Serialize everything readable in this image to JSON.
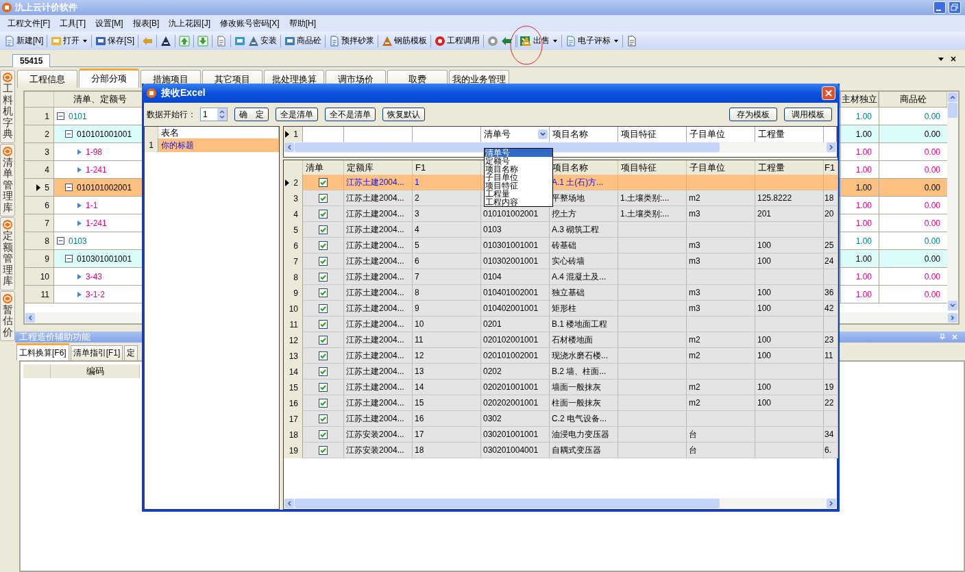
{
  "window": {
    "title": "氿上云计价软件"
  },
  "menu": [
    "工程文件[F]",
    "工具[T]",
    "设置[M]",
    "报表[B]",
    "氿上花园[J]",
    "修改账号密码[X]",
    "帮助[H]"
  ],
  "toolbar": [
    {
      "kind": "button",
      "label": "新建[N]",
      "dropdown": false
    },
    {
      "kind": "separator"
    },
    {
      "kind": "button",
      "label": "打开",
      "dropdown": true
    },
    {
      "kind": "separator"
    },
    {
      "kind": "button",
      "label": "保存[S]",
      "dropdown": false
    },
    {
      "kind": "separator"
    },
    {
      "kind": "icon"
    },
    {
      "kind": "separator"
    },
    {
      "kind": "icon"
    },
    {
      "kind": "separator"
    },
    {
      "kind": "icon"
    },
    {
      "kind": "separator"
    },
    {
      "kind": "icon"
    },
    {
      "kind": "separator"
    },
    {
      "kind": "icon"
    },
    {
      "kind": "separator"
    },
    {
      "kind": "icon"
    },
    {
      "kind": "button",
      "label": "安装",
      "dropdown": false
    },
    {
      "kind": "separator"
    },
    {
      "kind": "button",
      "label": "商品砼",
      "dropdown": false
    },
    {
      "kind": "separator"
    },
    {
      "kind": "button",
      "label": "预拌砂浆",
      "dropdown": false
    },
    {
      "kind": "separator"
    },
    {
      "kind": "button",
      "label": "钢筋模板",
      "dropdown": false
    },
    {
      "kind": "separator"
    },
    {
      "kind": "button",
      "label": "工程调用",
      "dropdown": false
    },
    {
      "kind": "separator"
    },
    {
      "kind": "icon"
    },
    {
      "kind": "icon"
    },
    {
      "kind": "separator"
    },
    {
      "kind": "icon"
    },
    {
      "kind": "separator"
    },
    {
      "kind": "button",
      "label": "出售",
      "dropdown": true
    },
    {
      "kind": "separator"
    },
    {
      "kind": "button",
      "label": "电子评标",
      "dropdown": true
    },
    {
      "kind": "separator"
    },
    {
      "kind": "icon"
    }
  ],
  "doc_tabs": [
    {
      "label": "55415",
      "selected": true
    }
  ],
  "side_tabs": [
    "工料机字典",
    "清单管理库",
    "定额管理库",
    "暂估价"
  ],
  "tabs": [
    {
      "label": "工程信息",
      "selected": false
    },
    {
      "label": "分部分项",
      "selected": true
    },
    {
      "label": "措施项目",
      "selected": false
    },
    {
      "label": "其它项目",
      "selected": false
    },
    {
      "label": "批处理换算",
      "selected": false
    },
    {
      "label": "调市场价",
      "selected": false
    },
    {
      "label": "取费",
      "selected": false
    },
    {
      "label": "我的业务管理",
      "selected": false
    }
  ],
  "grid": {
    "columns": [
      "清单、定额号",
      "主材独立",
      "商品砼"
    ],
    "rows": [
      {
        "no": "1",
        "kind": "group",
        "expanded": true,
        "code": "0101",
        "values": [
          "1.00",
          "0.00"
        ],
        "selected": false
      },
      {
        "no": "2",
        "kind": "list",
        "expanded": true,
        "code": "010101001001",
        "values": [
          "1.00",
          "0.00"
        ],
        "selected": false
      },
      {
        "no": "3",
        "kind": "quota",
        "code": "1-98",
        "values": [
          "1.00",
          "0.00"
        ],
        "selected": false
      },
      {
        "no": "4",
        "kind": "quota",
        "code": "1-241",
        "values": [
          "1.00",
          "0.00"
        ],
        "selected": false
      },
      {
        "no": "5",
        "kind": "list",
        "expanded": true,
        "code": "010101002001",
        "values": [
          "1.00",
          "0.00"
        ],
        "selected": true
      },
      {
        "no": "6",
        "kind": "quota",
        "code": "1-1",
        "values": [
          "1.00",
          "0.00"
        ],
        "selected": false
      },
      {
        "no": "7",
        "kind": "quota",
        "code": "1-241",
        "values": [
          "1.00",
          "0.00"
        ],
        "selected": false
      },
      {
        "no": "8",
        "kind": "group",
        "expanded": true,
        "code": "0103",
        "values": [
          "1.00",
          "0.00"
        ],
        "selected": false
      },
      {
        "no": "9",
        "kind": "list",
        "expanded": true,
        "code": "010301001001",
        "values": [
          "1.00",
          "0.00"
        ],
        "selected": false
      },
      {
        "no": "10",
        "kind": "quota",
        "code": "3-43",
        "values": [
          "1.00",
          "0.00"
        ],
        "selected": false
      },
      {
        "no": "11",
        "kind": "quota",
        "code": "3-1-2",
        "values": [
          "1.00",
          "0.00"
        ],
        "selected": false
      }
    ]
  },
  "bottom_panel": {
    "title": "工程造价辅助功能",
    "tabs": [
      {
        "label": "工料换算[F6]",
        "selected": true
      },
      {
        "label": "清单指引[F1]",
        "selected": false
      },
      {
        "label": "定",
        "selected": false
      }
    ],
    "columns": [
      "编码"
    ]
  },
  "dialog": {
    "title": "接收Excel",
    "start_row_label": "数据开始行：",
    "start_row": "1",
    "buttons": [
      "确　定",
      "全是清单",
      "全不是清单",
      "恢复默认"
    ],
    "right_buttons": [
      "存为模板",
      "调用模板"
    ],
    "sheets": {
      "column": "表名",
      "rows": [
        {
          "no": "1",
          "name": "你的标题",
          "selected": true
        }
      ]
    },
    "mapping": {
      "row": "1",
      "cells": [
        {
          "kind": "empty"
        },
        {
          "kind": "empty"
        },
        {
          "kind": "empty"
        },
        {
          "kind": "combo",
          "value": "清单号"
        },
        {
          "kind": "text",
          "value": "项目名称"
        },
        {
          "kind": "text",
          "value": "项目特征"
        },
        {
          "kind": "text",
          "value": "子目单位"
        },
        {
          "kind": "text",
          "value": "工程量"
        }
      ]
    },
    "dropdown": [
      {
        "label": "清单号",
        "selected": true
      },
      {
        "label": "定额号",
        "selected": false
      },
      {
        "label": "项目名称",
        "selected": false
      },
      {
        "label": "子目单位",
        "selected": false
      },
      {
        "label": "项目特征",
        "selected": false
      },
      {
        "label": "工程量",
        "selected": false
      },
      {
        "label": "工程内容",
        "selected": false
      }
    ],
    "table": {
      "columns_left": [
        "清单",
        "定额库",
        "F1"
      ],
      "columns_right": [
        "项目名称",
        "项目特征",
        "子目单位",
        "工程量",
        "F1"
      ],
      "rows": [
        {
          "no": "2",
          "checked": true,
          "selected": true,
          "library": "江苏土建2004...",
          "f1": "1",
          "name": "A.1 土(石)方..."
        },
        {
          "no": "3",
          "checked": true,
          "selected": false,
          "library": "江苏土建2004...",
          "f1": "2",
          "name": "平整场地",
          "feature": "1.土壤类别:...",
          "unit": "m2",
          "qty": "125.8222",
          "f1b": "18"
        },
        {
          "no": "4",
          "checked": true,
          "selected": false,
          "library": "江苏土建2004...",
          "f1": "3",
          "code": "010101002001",
          "name": "挖土方",
          "feature": "1.土壤类别:...",
          "unit": "m3",
          "qty": "201",
          "f1b": "20"
        },
        {
          "no": "5",
          "checked": true,
          "selected": false,
          "library": "江苏土建2004...",
          "f1": "4",
          "code": "0103",
          "name": "A.3 砌筑工程"
        },
        {
          "no": "6",
          "checked": true,
          "selected": false,
          "library": "江苏土建2004...",
          "f1": "5",
          "code": "010301001001",
          "name": "砖基础",
          "unit": "m3",
          "qty": "100",
          "f1b": "25"
        },
        {
          "no": "7",
          "checked": true,
          "selected": false,
          "library": "江苏土建2004...",
          "f1": "6",
          "code": "010302001001",
          "name": "实心砖墙",
          "unit": "m3",
          "qty": "100",
          "f1b": "24"
        },
        {
          "no": "8",
          "checked": true,
          "selected": false,
          "library": "江苏土建2004...",
          "f1": "7",
          "code": "0104",
          "name": "A.4 混凝土及..."
        },
        {
          "no": "9",
          "checked": true,
          "selected": false,
          "library": "江苏土建2004...",
          "f1": "8",
          "code": "010401002001",
          "name": "独立基础",
          "unit": "m3",
          "qty": "100",
          "f1b": "36"
        },
        {
          "no": "10",
          "checked": true,
          "selected": false,
          "library": "江苏土建2004...",
          "f1": "9",
          "code": "010402001001",
          "name": "矩形柱",
          "unit": "m3",
          "qty": "100",
          "f1b": "42"
        },
        {
          "no": "11",
          "checked": true,
          "selected": false,
          "library": "江苏土建2004...",
          "f1": "10",
          "code": "0201",
          "name": "B.1 楼地面工程"
        },
        {
          "no": "12",
          "checked": true,
          "selected": false,
          "library": "江苏土建2004...",
          "f1": "11",
          "code": "020102001001",
          "name": "石材楼地面",
          "unit": "m2",
          "qty": "100",
          "f1b": "23"
        },
        {
          "no": "13",
          "checked": true,
          "selected": false,
          "library": "江苏土建2004...",
          "f1": "12",
          "code": "020101002001",
          "name": "现浇水磨石楼...",
          "unit": "m2",
          "qty": "100",
          "f1b": "11"
        },
        {
          "no": "14",
          "checked": true,
          "selected": false,
          "library": "江苏土建2004...",
          "f1": "13",
          "code": "0202",
          "name": "B.2 墙、柱面..."
        },
        {
          "no": "15",
          "checked": true,
          "selected": false,
          "library": "江苏土建2004...",
          "f1": "14",
          "code": "020201001001",
          "name": "墙面一般抹灰",
          "unit": "m2",
          "qty": "100",
          "f1b": "19"
        },
        {
          "no": "16",
          "checked": true,
          "selected": false,
          "library": "江苏土建2004...",
          "f1": "15",
          "code": "020202001001",
          "name": "柱面一般抹灰",
          "unit": "m2",
          "qty": "100",
          "f1b": "22"
        },
        {
          "no": "17",
          "checked": true,
          "selected": false,
          "library": "江苏土建2004...",
          "f1": "16",
          "code": "0302",
          "name": "C.2 电气设备..."
        },
        {
          "no": "18",
          "checked": true,
          "selected": false,
          "library": "江苏安装2004...",
          "f1": "17",
          "code": "030201001001",
          "name": "油浸电力变压器",
          "unit": "台",
          "f1b": "34"
        },
        {
          "no": "19",
          "checked": true,
          "selected": false,
          "library": "江苏安装2004...",
          "f1": "18",
          "code": "030201004001",
          "name": "自耦式变压器",
          "unit": "台",
          "f1b": "6."
        }
      ]
    }
  }
}
